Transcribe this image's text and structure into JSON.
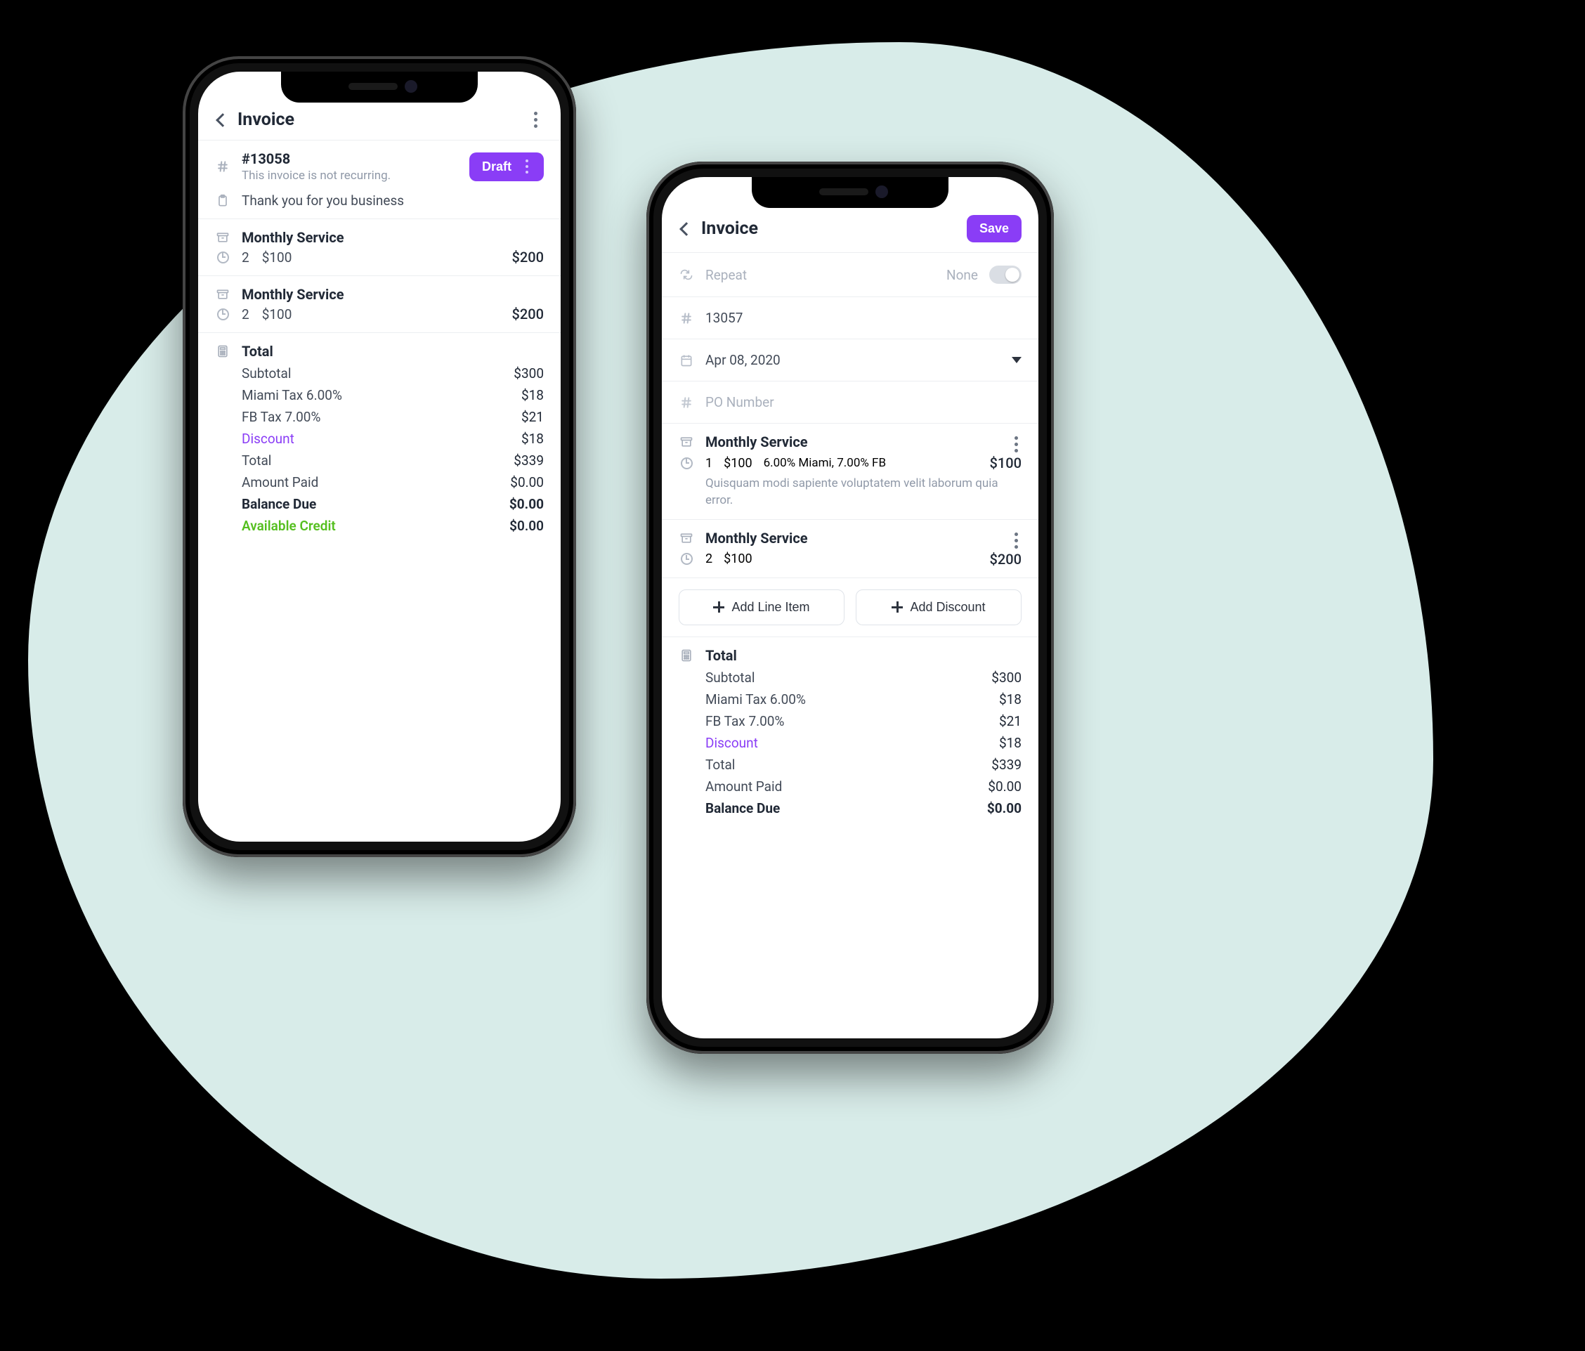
{
  "colors": {
    "accent": "#8a3df6",
    "green": "#55bf1f",
    "muted": "#9099a8"
  },
  "phone_left": {
    "nav_title": "Invoice",
    "invoice": {
      "number": "#13058",
      "recurring_note": "This invoice is not recurring.",
      "status_button": "Draft",
      "note": "Thank you for you business"
    },
    "line_items": [
      {
        "name": "Monthly Service",
        "qty": "2",
        "price": "$100",
        "amount": "$200"
      },
      {
        "name": "Monthly Service",
        "qty": "2",
        "price": "$100",
        "amount": "$200"
      }
    ],
    "totals": {
      "heading": "Total",
      "subtotal_label": "Subtotal",
      "subtotal_value": "$300",
      "tax1_label": "Miami Tax 6.00%",
      "tax1_value": "$18",
      "tax2_label": "FB Tax 7.00%",
      "tax2_value": "$21",
      "discount_label": "Discount",
      "discount_value": "$18",
      "total_label": "Total",
      "total_value": "$339",
      "paid_label": "Amount Paid",
      "paid_value": "$0.00",
      "balance_label": "Balance Due",
      "balance_value": "$0.00",
      "credit_label": "Available Credit",
      "credit_value": "$0.00"
    }
  },
  "phone_right": {
    "nav_title": "Invoice",
    "save_button": "Save",
    "repeat": {
      "label": "Repeat",
      "value": "None"
    },
    "number_value": "13057",
    "date_value": "Apr 08, 2020",
    "po_placeholder": "PO Number",
    "line_items": [
      {
        "name": "Monthly Service",
        "qty": "1",
        "price": "$100",
        "tax_summary": "6.00% Miami, 7.00% FB",
        "amount": "$100",
        "description": "Quisquam modi sapiente voluptatem velit laborum quia error."
      },
      {
        "name": "Monthly Service",
        "qty": "2",
        "price": "$100",
        "amount": "$200"
      }
    ],
    "buttons": {
      "add_line_item": "Add Line Item",
      "add_discount": "Add Discount"
    },
    "totals": {
      "heading": "Total",
      "subtotal_label": "Subtotal",
      "subtotal_value": "$300",
      "tax1_label": "Miami Tax 6.00%",
      "tax1_value": "$18",
      "tax2_label": "FB Tax 7.00%",
      "tax2_value": "$21",
      "discount_label": "Discount",
      "discount_value": "$18",
      "total_label": "Total",
      "total_value": "$339",
      "paid_label": "Amount Paid",
      "paid_value": "$0.00",
      "balance_label": "Balance Due",
      "balance_value": "$0.00"
    }
  }
}
